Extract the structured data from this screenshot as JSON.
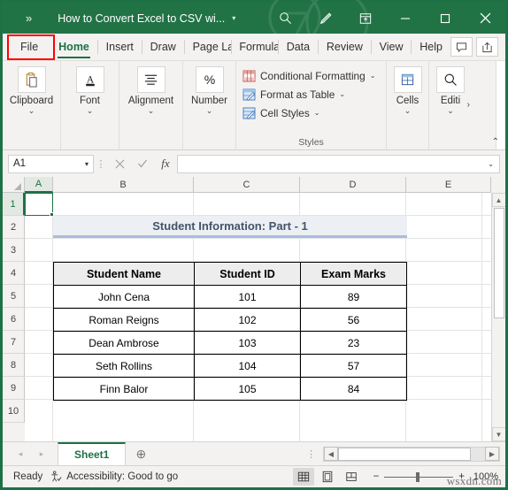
{
  "titlebar": {
    "overflow_chevron": "»",
    "document_title": "How to Convert Excel to CSV wi...",
    "title_caret": "▾",
    "search_icon": "search-icon",
    "pen_icon": "pen-icon",
    "ribbon_display_icon": "ribbon-display-options-icon",
    "minimize_label": "—",
    "maximize_label": "▢",
    "close_label": "✕",
    "bg_color": "#217346"
  },
  "ribbon_tabs": {
    "file": "File",
    "items": [
      "Home",
      "Insert",
      "Draw",
      "Page La",
      "Formula",
      "Data",
      "Review",
      "View",
      "Help"
    ],
    "active": "Home",
    "comment_icon": "comment-icon",
    "share_icon": "share-icon",
    "highlight_color": "#ff0000"
  },
  "ribbon": {
    "groups": [
      {
        "label": "Clipboard",
        "icon": "clipboard-icon",
        "chevron": "⌄"
      },
      {
        "label": "Font",
        "icon": "font-icon",
        "chevron": "⌄"
      },
      {
        "label": "Alignment",
        "icon": "alignment-icon",
        "chevron": "⌄"
      },
      {
        "label": "Number",
        "icon": "percent-icon",
        "chevron": "⌄"
      }
    ],
    "styles": {
      "group_title": "Styles",
      "items": [
        {
          "label": "Conditional Formatting",
          "icon": "conditional-formatting-icon",
          "caret": "⌄"
        },
        {
          "label": "Format as Table",
          "icon": "format-as-table-icon",
          "caret": "⌄"
        },
        {
          "label": "Cell Styles",
          "icon": "cell-styles-icon",
          "caret": "⌄"
        }
      ]
    },
    "cells": {
      "label": "Cells",
      "icon": "cells-icon",
      "chevron": "⌄"
    },
    "editing": {
      "label": "Editi",
      "icon": "find-icon",
      "chevron": "⌄",
      "overflow": "›"
    },
    "collapse_chevron": "⌃"
  },
  "formula_bar": {
    "name_box_value": "A1",
    "name_box_caret": "▾",
    "cancel_icon": "cancel-icon",
    "enter_icon": "confirm-icon",
    "fx_label": "fx",
    "formula_value": "",
    "expand_caret": "⌄"
  },
  "grid": {
    "columns": [
      "A",
      "B",
      "C",
      "D",
      "E"
    ],
    "rows": [
      "1",
      "2",
      "3",
      "4",
      "5",
      "6",
      "7",
      "8",
      "9",
      "10"
    ],
    "selected_cell": "A1",
    "sheet_title": "Student Information: Part - 1",
    "table": {
      "headers": [
        "Student Name",
        "Student ID",
        "Exam Marks"
      ],
      "rows": [
        [
          "John Cena",
          "101",
          "89"
        ],
        [
          "Roman Reigns",
          "102",
          "56"
        ],
        [
          "Dean Ambrose",
          "103",
          "23"
        ],
        [
          "Seth Rollins",
          "104",
          "57"
        ],
        [
          "Finn Balor",
          "105",
          "84"
        ]
      ]
    }
  },
  "sheet_bar": {
    "prev_arrow": "◂",
    "next_arrow": "▸",
    "tabs": [
      "Sheet1"
    ],
    "active_tab": "Sheet1",
    "add_sheet_icon": "add-sheet-icon",
    "dots": "⋮",
    "scroll_left": "◀",
    "scroll_right": "▶"
  },
  "status_bar": {
    "status": "Ready",
    "accessibility_icon": "accessibility-icon",
    "accessibility": "Accessibility: Good to go",
    "view_normal_icon": "normal-view-icon",
    "view_layout_icon": "page-layout-icon",
    "view_break_icon": "page-break-preview-icon",
    "zoom_out": "−",
    "zoom_in": "+",
    "zoom_level": "100%",
    "watermark": "wsxdn.com"
  }
}
